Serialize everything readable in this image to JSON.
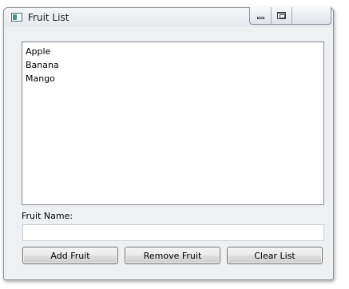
{
  "window": {
    "title": "Fruit List",
    "icons": {
      "app": "app-window-icon",
      "minimize": "minimize-icon",
      "maximize": "maximize-icon"
    }
  },
  "fruit_list": {
    "items": [
      "Apple",
      "Banana",
      "Mango"
    ]
  },
  "form": {
    "fruit_name_label": "Fruit Name:",
    "fruit_name_value": ""
  },
  "buttons": {
    "add_label": "Add Fruit",
    "remove_label": "Remove Fruit",
    "clear_label": "Clear List"
  }
}
